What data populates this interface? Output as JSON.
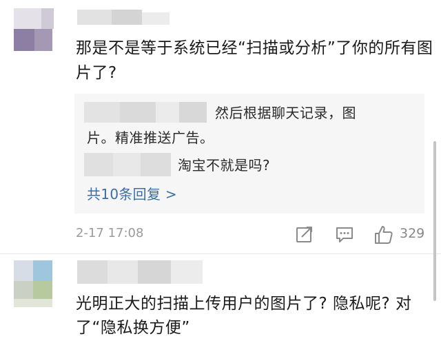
{
  "comment1": {
    "text": "那是不是等于系统已经“扫描或分析”了你的所有图片了?"
  },
  "replies": {
    "reply1_text_a": "然后根据聊天记录，图",
    "reply1_text_b": "片。精准推送广告。",
    "reply2_text": "淘宝不就是吗?",
    "more_link": "共10条回复 >"
  },
  "meta": {
    "timestamp": "2-17 17:08",
    "like_count": "329"
  },
  "comment2": {
    "text": "光明正大的扫描上传用户的图片了? 隐私呢? 对了“隐私换方便”"
  },
  "colors": {
    "link": "#3b6da5",
    "muted": "#9a9a9a",
    "reply_bg": "#f6f6f6"
  },
  "icons": [
    "share-icon",
    "comment-icon",
    "like-icon"
  ]
}
